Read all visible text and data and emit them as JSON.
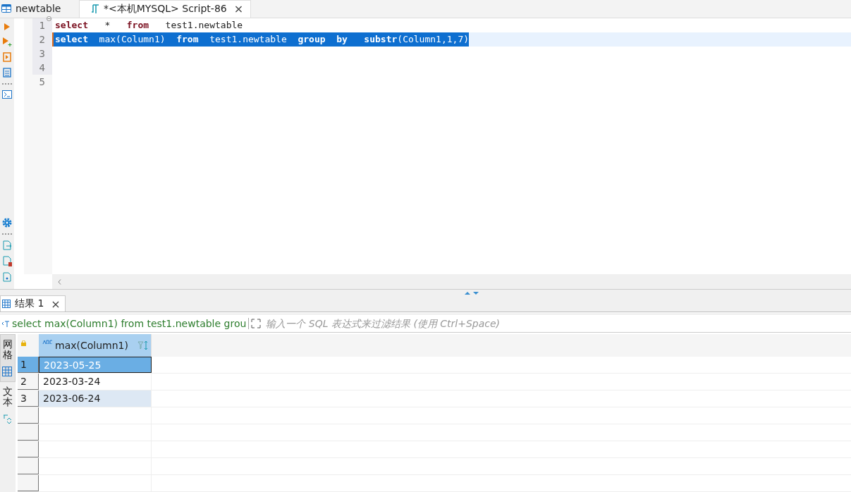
{
  "editor_tabs": [
    {
      "label": "newtable",
      "kind": "table",
      "selected": false
    },
    {
      "label": "*<本机MYSQL> Script-86",
      "kind": "script",
      "selected": true,
      "close_label": "×"
    }
  ],
  "editor": {
    "lines": [
      {
        "number": "1",
        "folded_marker": true,
        "selected": false,
        "tokens": [
          {
            "text": "select",
            "kind": "keyword"
          },
          {
            "text": "   *   ",
            "kind": "plain"
          },
          {
            "text": "from",
            "kind": "keyword"
          },
          {
            "text": "   test1.newtable",
            "kind": "plain"
          }
        ]
      },
      {
        "number": "2",
        "folded_marker": false,
        "selected": true,
        "tokens": [
          {
            "text": "select",
            "kind": "keyword"
          },
          {
            "text": "  max(Column1)  ",
            "kind": "plain"
          },
          {
            "text": "from",
            "kind": "keyword"
          },
          {
            "text": "  test1.newtable  ",
            "kind": "plain"
          },
          {
            "text": "group  ",
            "kind": "keyword"
          },
          {
            "text": "by   ",
            "kind": "keyword"
          },
          {
            "text": "substr",
            "kind": "keyword"
          },
          {
            "text": "(Column1,1,7)",
            "kind": "plain"
          }
        ]
      },
      {
        "number": "3",
        "folded_marker": false,
        "selected": false
      },
      {
        "number": "4",
        "folded_marker": false,
        "selected": false
      },
      {
        "number": "5",
        "folded_marker": false,
        "selected": false
      }
    ]
  },
  "results_tab": {
    "label": "结果 1",
    "selected": true,
    "close_label": "×"
  },
  "filter_bar": {
    "query": "select max(Column1) from test1.newtable grou",
    "placeholder": "输入一个 SQL 表达式来过滤结果 (使用 Ctrl+Space)"
  },
  "view_tabs": [
    {
      "label": "网格",
      "selected": true
    },
    {
      "label": "文本",
      "selected": false
    }
  ],
  "grid": {
    "columns": [
      {
        "label": "max(Column1)"
      }
    ],
    "rows": [
      {
        "number": "1",
        "value": "2023-05-25",
        "selected": true,
        "highlighted": false
      },
      {
        "number": "2",
        "value": "2023-03-24",
        "selected": false,
        "highlighted": false
      },
      {
        "number": "3",
        "value": "2023-06-24",
        "selected": false,
        "highlighted": true
      }
    ]
  }
}
